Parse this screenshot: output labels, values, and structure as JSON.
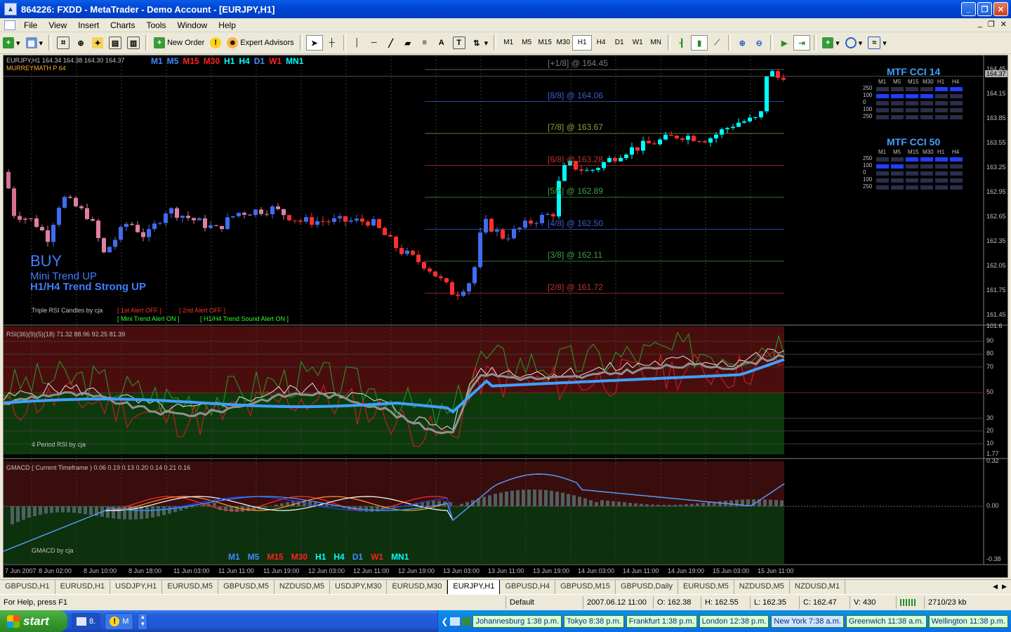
{
  "window": {
    "title": "864226: FXDD - MetaTrader - Demo Account - [EURJPY,H1]",
    "btn_minimize": "_",
    "btn_restore": "❐",
    "btn_close": "✕"
  },
  "menu": [
    "File",
    "View",
    "Insert",
    "Charts",
    "Tools",
    "Window",
    "Help"
  ],
  "toolbar": {
    "new_order": "New Order",
    "expert_advisors": "Expert Advisors",
    "timeframes": [
      "M1",
      "M5",
      "M15",
      "M30",
      "H1",
      "H4",
      "D1",
      "W1",
      "MN"
    ],
    "active_timeframe": "H1"
  },
  "chart": {
    "symbol_info": "EURJPY,H1  164.34 164.38 164.30 164.37",
    "murrey": "MURREYMATH  P 64",
    "tf_labels": [
      {
        "t": "M1",
        "c": "#3f8cff"
      },
      {
        "t": "M5",
        "c": "#3f8cff"
      },
      {
        "t": "M15",
        "c": "#ff2020"
      },
      {
        "t": "M30",
        "c": "#ff2020"
      },
      {
        "t": "H1",
        "c": "#00ffff"
      },
      {
        "t": "H4",
        "c": "#00ffff"
      },
      {
        "t": "D1",
        "c": "#3f8cff"
      },
      {
        "t": "W1",
        "c": "#ff2020"
      },
      {
        "t": "MN1",
        "c": "#00ffff"
      }
    ],
    "buy": "BUY",
    "mini_trend": "Mini Trend UP",
    "trend_strong": "H1/H4 Trend Strong UP",
    "triple_rsi": "Triple RSI Candles by cja",
    "alert1": "[ 1st Alert OFF ]",
    "alert2": "[ 2nd Alert OFF ]",
    "alert3": "[ Mini Trend Alert ON ]",
    "alert4": "[ H1/H4 Trend Sound Alert ON ]",
    "price_scale": [
      "164.45",
      "164.15",
      "163.85",
      "163.55",
      "163.25",
      "162.95",
      "162.65",
      "162.35",
      "162.05",
      "161.75",
      "161.45"
    ],
    "current_price": "164.37",
    "mm_levels": [
      {
        "label": "[+1/8]  @   164.45",
        "price": 164.45,
        "color": "#7b7b7b"
      },
      {
        "label": "[8/8]  @   164.06",
        "price": 164.06,
        "color": "#3a5fd0"
      },
      {
        "label": "[7/8]  @   163.67",
        "price": 163.67,
        "color": "#9a9a40"
      },
      {
        "label": "[6/8]  @   163.28",
        "price": 163.28,
        "color": "#c03030"
      },
      {
        "label": "[5/8]  @   162.89",
        "price": 162.89,
        "color": "#40a040"
      },
      {
        "label": "[4/8]  @   162.50",
        "price": 162.5,
        "color": "#3a5fd0"
      },
      {
        "label": "[3/8]  @   162.11",
        "price": 162.11,
        "color": "#40a040"
      },
      {
        "label": "[2/8]  @   161.72",
        "price": 161.72,
        "color": "#c03030"
      }
    ],
    "cci14": {
      "title": "MTF CCI  14",
      "cols": [
        "M1",
        "M5",
        "M15",
        "M30",
        "H1",
        "H4"
      ],
      "rows": [
        "250",
        "100",
        "0",
        "100",
        "250"
      ]
    },
    "cci50": {
      "title": "MTF CCI  50",
      "cols": [
        "M1",
        "M5",
        "M15",
        "M30",
        "H1",
        "H4"
      ],
      "rows": [
        "250",
        "100",
        "0",
        "100",
        "250"
      ]
    },
    "rsi_label": "RSI(36)(9)(5)(18) 71.32 88.96 92.25 81.39",
    "rsi_by": "4 Period RSI by cja",
    "rsi_scale": [
      "101.6",
      "90",
      "80",
      "70",
      "50",
      "30",
      "20",
      "10",
      "1.77"
    ],
    "gmacd_label": "GMACD  (  Current Timeframe  ) 0.06 0.19 0.13 0.20 0.14 0.21 0.16",
    "gmacd_by": "GMACD by cja",
    "gmacd_scale": [
      "0.32",
      "0.00",
      "-0.38"
    ],
    "time_labels": [
      "7 Jun 2007",
      "8 Jun 02:00",
      "8 Jun 10:00",
      "8 Jun 18:00",
      "11 Jun 03:00",
      "11 Jun 11:00",
      "11 Jun 19:00",
      "12 Jun 03:00",
      "12 Jun 11:00",
      "12 Jun 19:00",
      "13 Jun 03:00",
      "13 Jun 11:00",
      "13 Jun 19:00",
      "14 Jun 03:00",
      "14 Jun 11:00",
      "14 Jun 19:00",
      "15 Jun 03:00",
      "15 Jun 11:00"
    ]
  },
  "tabs": [
    "GBPUSD,H1",
    "EURUSD,H1",
    "USDJPY,H1",
    "EURUSD,M5",
    "GBPUSD,M5",
    "NZDUSD,M5",
    "USDJPY,M30",
    "EURUSD,M30",
    "EURJPY,H1",
    "GBPUSD,H4",
    "GBPUSD,M15",
    "GBPUSD,Daily",
    "EURUSD,M5",
    "NZDUSD,M5",
    "NZDUSD,M1"
  ],
  "active_tab": "EURJPY,H1",
  "status": {
    "help": "For Help, press F1",
    "profile": "Default",
    "datetime": "2007.06.12 11:00",
    "open": "O: 162.38",
    "high": "H: 162.55",
    "low": "L: 162.35",
    "close": "C: 162.47",
    "volume": "V: 430",
    "traffic": "2710/23 kb"
  },
  "taskbar": {
    "start": "start",
    "btn1": "8.",
    "btn2": "M",
    "clocks": [
      "Johannesburg 1:38 p.m.",
      "Tokyo 8:38 p.m.",
      "Frankfurt 1:38 p.m.",
      "London 12:38 p.m.",
      "New York 7:38 a.m.",
      "Greenwich 11:38 a.m.",
      "Wellington 11:38 p.m."
    ]
  }
}
